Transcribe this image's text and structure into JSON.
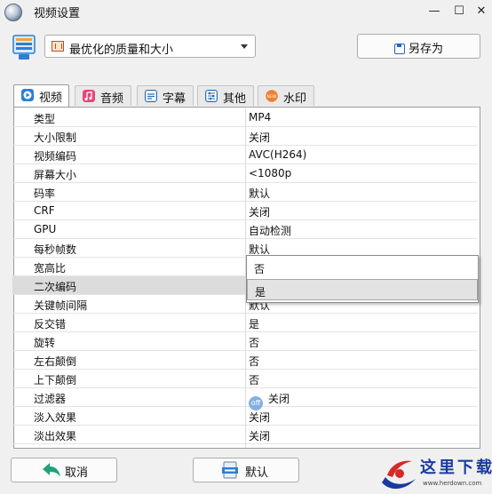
{
  "window": {
    "title": "视频设置",
    "minimize": "—",
    "maximize": "☐",
    "close": "✕"
  },
  "preset": {
    "value": "最优化的质量和大小"
  },
  "buttons": {
    "save_as": "另存为",
    "cancel": "取消",
    "default": "默认"
  },
  "tabs": [
    {
      "label": "视频",
      "icon": "video-icon",
      "color": "#2b7fd6",
      "active": true
    },
    {
      "label": "音频",
      "icon": "music-icon",
      "color": "#e5467a"
    },
    {
      "label": "字幕",
      "icon": "subtitle-icon",
      "color": "#2a6db5"
    },
    {
      "label": "其他",
      "icon": "sliders-icon",
      "color": "#2a6db5"
    },
    {
      "label": "水印",
      "icon": "new-badge-icon",
      "color": "#f08030",
      "badge": "NEW"
    }
  ],
  "settings": [
    {
      "name": "类型",
      "value": "MP4"
    },
    {
      "name": "大小限制",
      "value": "关闭"
    },
    {
      "name": "视频编码",
      "value": "AVC(H264)"
    },
    {
      "name": "屏幕大小",
      "value": "<1080p"
    },
    {
      "name": "码率",
      "value": "默认"
    },
    {
      "name": "CRF",
      "value": "关闭"
    },
    {
      "name": "GPU",
      "value": "自动检测"
    },
    {
      "name": "每秒帧数",
      "value": "默认"
    },
    {
      "name": "宽高比",
      "value": ""
    },
    {
      "name": "二次编码",
      "value": ""
    },
    {
      "name": "关键帧间隔",
      "value": "默认"
    },
    {
      "name": "反交错",
      "value": "是"
    },
    {
      "name": "旋转",
      "value": "否"
    },
    {
      "name": "左右颠倒",
      "value": "否"
    },
    {
      "name": "上下颠倒",
      "value": "否"
    },
    {
      "name": "过滤器",
      "value": "关闭",
      "icon": "off-toggle-icon",
      "icon_text": "off"
    },
    {
      "name": "淡入效果",
      "value": "关闭"
    },
    {
      "name": "淡出效果",
      "value": "关闭"
    }
  ],
  "dropdown": {
    "options": [
      "否",
      "是"
    ],
    "selected": "是"
  },
  "watermark": {
    "title": "这里下载",
    "url": "www.herdown.com"
  },
  "colors": {
    "accent": "#2b7fd6",
    "watermark": "#1a3aa0",
    "selected_row": "#dcdcdc"
  }
}
